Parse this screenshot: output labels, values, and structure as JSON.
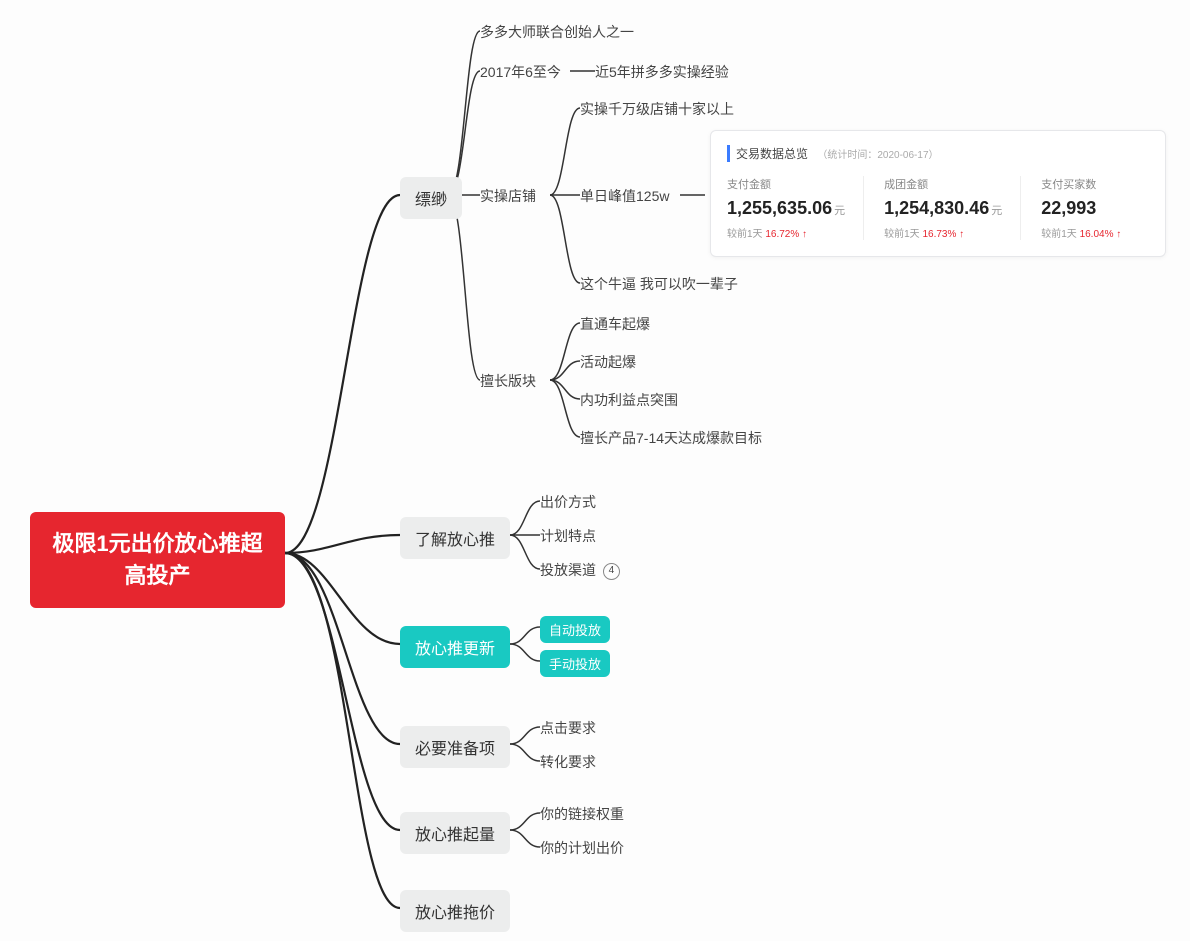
{
  "root": "极限1元出价放心推超高投产",
  "l1": {
    "a": "缥缈",
    "b": "了解放心推",
    "c": "放心推更新",
    "d": "必要准备项",
    "e": "放心推起量",
    "f": "放心推拖价"
  },
  "piaomiao": {
    "a": "多多大师联合创始人之一",
    "b": "2017年6至今",
    "b_sub": "近5年拼多多实操经验",
    "c": "实操店铺",
    "d": "擅长版块"
  },
  "shop": {
    "a": "实操千万级店铺十家以上",
    "b": "单日峰值125w",
    "c": "这个牛逼 我可以吹一辈子"
  },
  "skills": {
    "a": "直通车起爆",
    "b": "活动起爆",
    "c": "内功利益点突围",
    "d": "擅长产品7-14天达成爆款目标"
  },
  "liaojie": {
    "a": "出价方式",
    "b": "计划特点",
    "c": "投放渠道",
    "c_badge": "4"
  },
  "gengxin": {
    "a": "自动投放",
    "b": "手动投放"
  },
  "zhunbei": {
    "a": "点击要求",
    "b": "转化要求"
  },
  "qiliang": {
    "a": "你的链接权重",
    "b": "你的计划出价"
  },
  "card": {
    "title": "交易数据总览",
    "subtitle": "（统计时间：2020-06-17）",
    "cols": [
      {
        "label": "支付金额",
        "value": "1,255,635.06",
        "unit": "元",
        "delta_prefix": "较前1天",
        "delta": "16.72%"
      },
      {
        "label": "成团金额",
        "value": "1,254,830.46",
        "unit": "元",
        "delta_prefix": "较前1天",
        "delta": "16.73%"
      },
      {
        "label": "支付买家数",
        "value": "22,993",
        "unit": "",
        "delta_prefix": "较前1天",
        "delta": "16.04%"
      }
    ]
  }
}
